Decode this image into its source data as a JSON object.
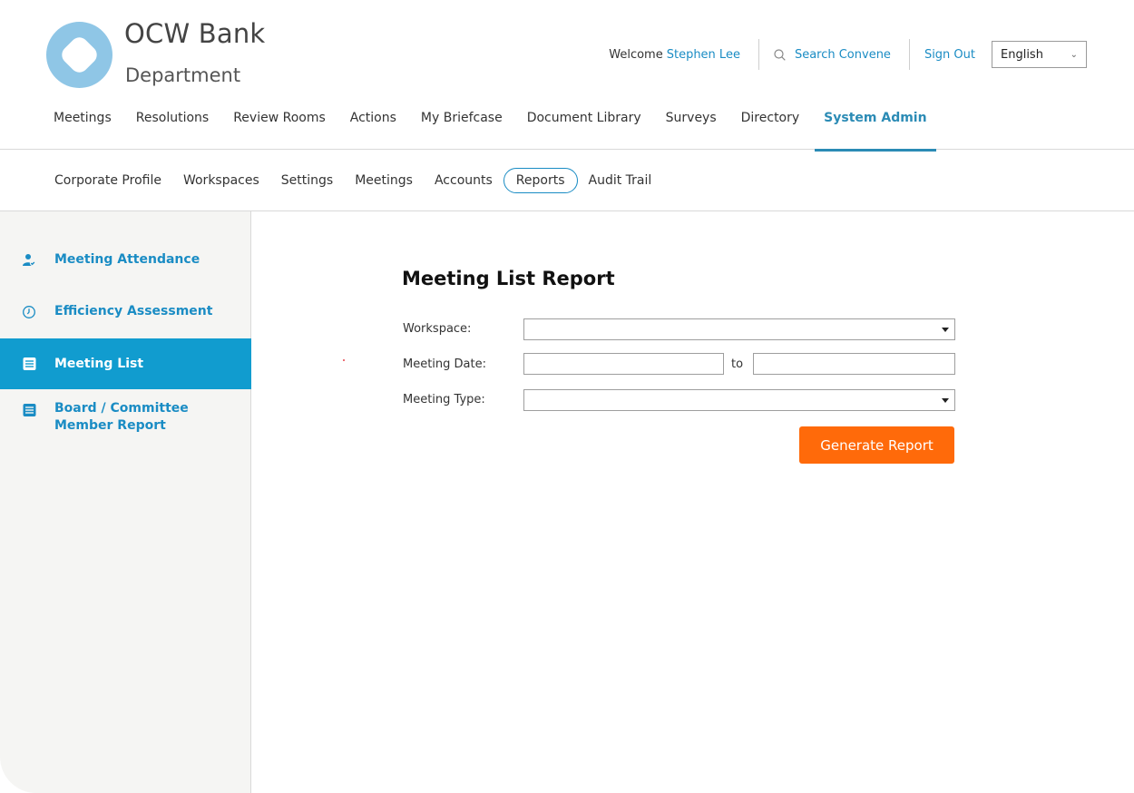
{
  "brand": {
    "name": "OCW Bank",
    "department": "Department"
  },
  "topbar": {
    "welcome_label": "Welcome",
    "user_name": "Stephen Lee",
    "search_label": "Search Convene",
    "signout_label": "Sign Out",
    "language": "English"
  },
  "main_nav": {
    "items": [
      "Meetings",
      "Resolutions",
      "Review Rooms",
      "Actions",
      "My Briefcase",
      "Document Library",
      "Surveys",
      "Directory",
      "System Admin"
    ],
    "active": "System Admin"
  },
  "sub_nav": {
    "items": [
      "Corporate Profile",
      "Workspaces",
      "Settings",
      "Meetings",
      "Accounts",
      "Reports",
      "Audit Trail"
    ],
    "active": "Reports"
  },
  "sidebar": {
    "items": [
      {
        "label": "Meeting Attendance",
        "icon": "user-check-icon"
      },
      {
        "label": "Efficiency Assessment",
        "icon": "clock-icon"
      },
      {
        "label": "Meeting List",
        "icon": "list-icon",
        "active": true
      },
      {
        "label_line1": "Board / Committee",
        "label_line2": "Member Report",
        "icon": "list-icon"
      }
    ]
  },
  "report": {
    "title": "Meeting List Report",
    "workspace_label": "Workspace:",
    "workspace_value": "",
    "meeting_date_label": "Meeting Date:",
    "date_from": "",
    "to_label": "to",
    "date_to": "",
    "meeting_type_label": "Meeting Type:",
    "meeting_type_value": "",
    "generate_label": "Generate Report"
  },
  "colors": {
    "accent": "#1a8cc4",
    "active_sidebar": "#119ccf",
    "button": "#ff6a0a",
    "logo": "#8fc6e6"
  }
}
